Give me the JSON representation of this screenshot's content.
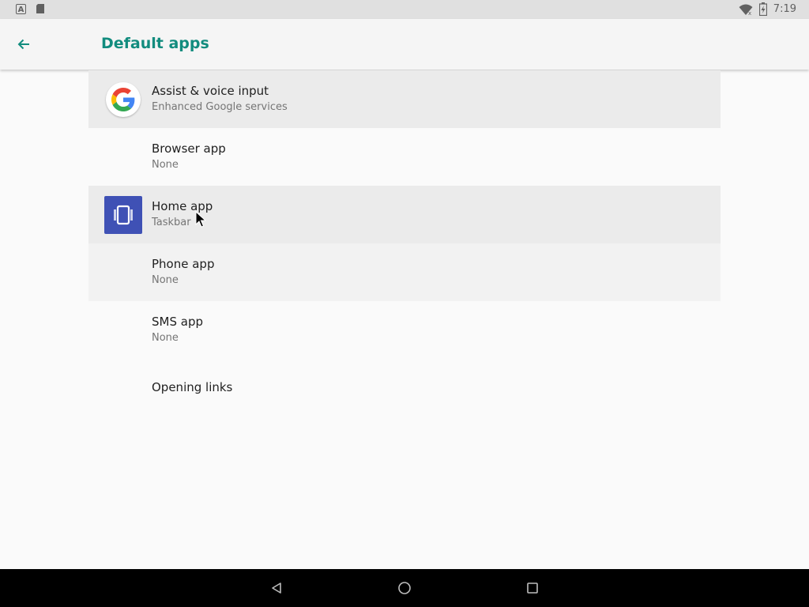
{
  "status_bar": {
    "time": "7:19",
    "left_icons": [
      "a-notification-icon",
      "sd-card-icon"
    ],
    "right_icons": [
      "wifi-icon",
      "battery-charging-icon"
    ]
  },
  "app_bar": {
    "title": "Default apps",
    "back_icon": "arrow-back-icon",
    "accent_color": "#128c7e"
  },
  "items": [
    {
      "title": "Assist & voice input",
      "subtitle": "Enhanced Google services",
      "icon": "google-icon"
    },
    {
      "title": "Browser app",
      "subtitle": "None",
      "icon": ""
    },
    {
      "title": "Home app",
      "subtitle": "Taskbar",
      "icon": "taskbar-icon"
    },
    {
      "title": "Phone app",
      "subtitle": "None",
      "icon": ""
    },
    {
      "title": "SMS app",
      "subtitle": "None",
      "icon": ""
    },
    {
      "title": "Opening links",
      "subtitle": "",
      "icon": ""
    }
  ],
  "nav_bar": {
    "buttons": [
      "back-triangle-icon",
      "home-circle-icon",
      "recents-square-icon"
    ]
  }
}
